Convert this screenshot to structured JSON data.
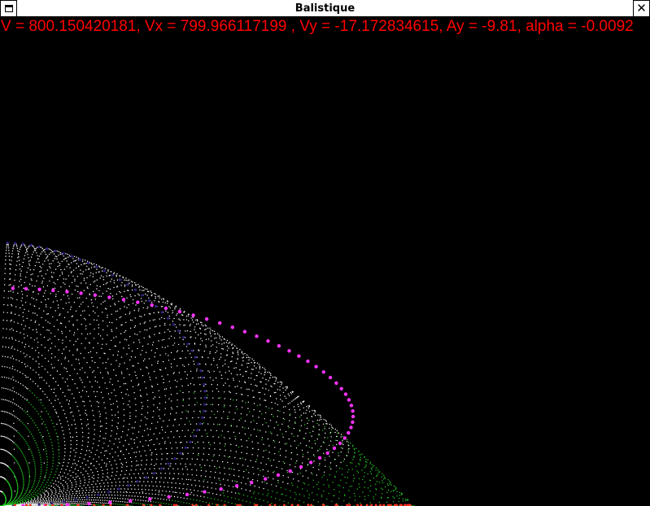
{
  "window": {
    "title": "Balistique",
    "menu_icon": "window-menu-icon",
    "close_icon": "close-icon",
    "close_glyph": "✕"
  },
  "status": {
    "text": "V = 800.150420181, Vx = 799.966117199 , Vy = -17.172834615, Ay = -9.81, alpha = -0.0092",
    "color": "#ff0000"
  },
  "colors": {
    "background": "#000000",
    "trajectory_upper": "#ffffff",
    "trajectory_lower": "#22cc22",
    "max_distance_curve": "#ff33ff",
    "apex_curve": "#2a1f7a",
    "impact_points": "#ff3322"
  }
}
